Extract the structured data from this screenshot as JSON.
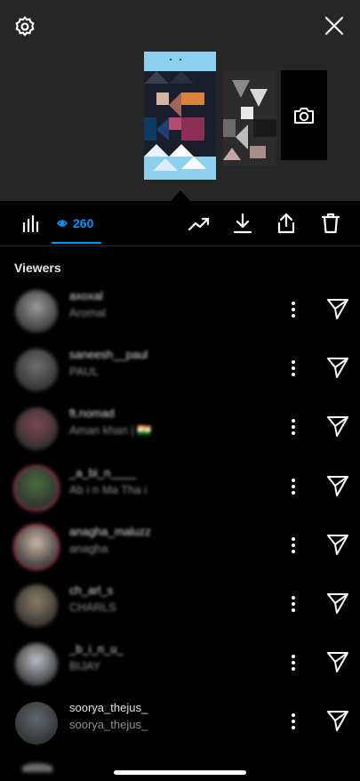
{
  "header": {
    "settings_icon": "gear-icon",
    "close_icon": "close-icon",
    "camera_icon": "camera-icon"
  },
  "toolbar": {
    "insights_icon": "bar-chart-icon",
    "views_icon": "eye-icon",
    "views_count": "260",
    "promote_icon": "trend-icon",
    "download_icon": "download-icon",
    "share_icon": "share-icon",
    "delete_icon": "trash-icon"
  },
  "viewers": {
    "title": "Viewers",
    "items": [
      {
        "username": "axoxal",
        "name": "Aromal",
        "ring": false,
        "avatar_color": "#9a9a9a"
      },
      {
        "username": "saneesh__paul",
        "name": "PAUL",
        "ring": false,
        "avatar_color": "#6f6f6f"
      },
      {
        "username": "ft.nomad",
        "name": "Aman khan | 🇮🇳",
        "ring": false,
        "avatar_color": "#7a4a52"
      },
      {
        "username": "_a_bi_n____",
        "name": "Ab i n Ma Tha i",
        "ring": true,
        "avatar_color": "#4b6a3e"
      },
      {
        "username": "anagha_maluzz",
        "name": "anagha",
        "ring": true,
        "avatar_color": "#c9b7a7"
      },
      {
        "username": "ch_arl_s",
        "name": "CHARLS",
        "ring": false,
        "avatar_color": "#8a7c66"
      },
      {
        "username": "_b_i_n_u_",
        "name": "BIJAY",
        "ring": false,
        "avatar_color": "#b9bec4"
      },
      {
        "username": "soorya_thejus_",
        "name": "soorya_thejus_",
        "ring": false,
        "avatar_color": "#5f6a6f"
      }
    ]
  },
  "colors": {
    "accent": "#0095f6",
    "panel": "#262626",
    "background": "#000000"
  }
}
